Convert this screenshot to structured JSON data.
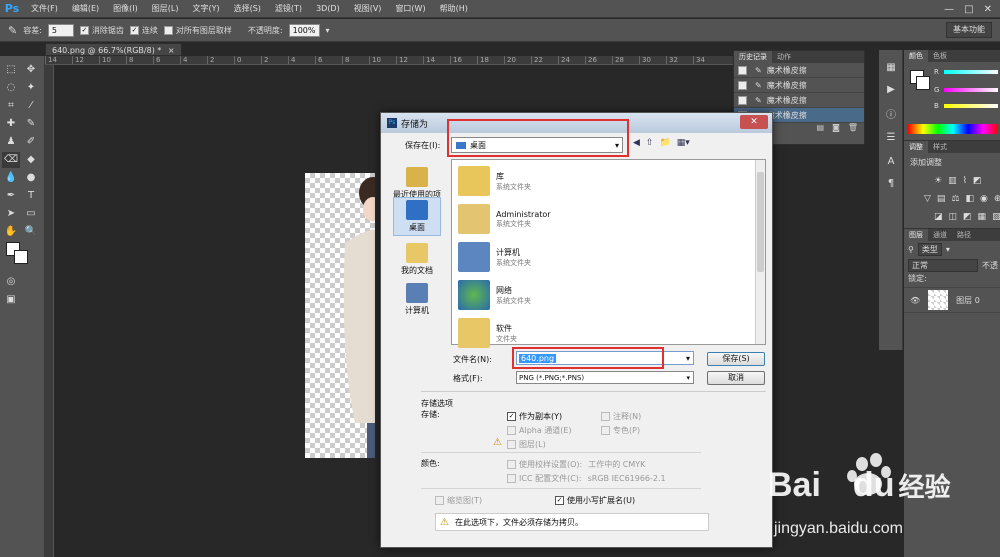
{
  "app": {
    "logo": "Ps"
  },
  "menu": [
    "文件(F)",
    "编辑(E)",
    "图像(I)",
    "图层(L)",
    "文字(Y)",
    "选择(S)",
    "滤镜(T)",
    "3D(D)",
    "视图(V)",
    "窗口(W)",
    "帮助(H)"
  ],
  "window_controls": [
    "—",
    "□",
    "✕"
  ],
  "options_bar": {
    "tolerance_label": "容差:",
    "tolerance_value": "5",
    "antialias_label": "消除锯齿",
    "antialias_checked": "✓",
    "contiguous_label": "连续",
    "contiguous_checked": "✓",
    "sample_all_label": "对所有图层取样",
    "opacity_label": "不透明度:",
    "opacity_value": "100%",
    "workspace": "基本功能"
  },
  "document": {
    "tab_label": "640.png @ 66.7%(RGB/8) *",
    "tab_close": "×"
  },
  "ruler_ticks": [
    "14",
    "12",
    "10",
    "8",
    "6",
    "4",
    "2",
    "0",
    "2",
    "4",
    "6",
    "8",
    "10",
    "12",
    "14",
    "16",
    "18",
    "20",
    "22",
    "24",
    "26",
    "28",
    "30",
    "32",
    "34"
  ],
  "history_panel": {
    "tabs": [
      "历史记录",
      "动作"
    ],
    "items": [
      "魔术橡皮擦",
      "魔术橡皮擦",
      "魔术橡皮擦",
      "魔术橡皮擦"
    ]
  },
  "color_panel": {
    "tabs": [
      "颜色",
      "色板"
    ],
    "channels": [
      "R",
      "G",
      "B"
    ]
  },
  "adjust_panel": {
    "tabs": [
      "调整",
      "样式"
    ],
    "title": "添加调整"
  },
  "layers_panel": {
    "tabs": [
      "图层",
      "通道",
      "路径"
    ],
    "kind": "类型",
    "blend_mode": "正常",
    "opacity_label": "不透",
    "lock_label": "锁定:",
    "layer_name": "图层 0"
  },
  "dialog": {
    "title": "存储为",
    "close": "✕",
    "save_in_label": "保存在(I):",
    "save_in_value": "桌面",
    "places": [
      "最近使用的项目",
      "桌面",
      "我的文档",
      "计算机"
    ],
    "files": [
      {
        "name": "库",
        "type": "系统文件夹"
      },
      {
        "name": "Administrator",
        "type": "系统文件夹"
      },
      {
        "name": "计算机",
        "type": "系统文件夹"
      },
      {
        "name": "网络",
        "type": "系统文件夹"
      },
      {
        "name": "软件",
        "type": "文件夹"
      }
    ],
    "filename_label": "文件名(N):",
    "filename_value": "640.png",
    "format_label": "格式(F):",
    "format_value": "PNG (*.PNG;*.PNS)",
    "save_button": "保存(S)",
    "cancel_button": "取消",
    "options_title": "存储选项",
    "storage_label": "存储:",
    "as_copy": "作为副本(Y)",
    "notes": "注释(N)",
    "alpha": "Alpha 通道(E)",
    "spot": "专色(P)",
    "layers": "图层(L)",
    "color_label": "颜色:",
    "proof": "使用校样设置(O):",
    "proof_value": "工作中的 CMYK",
    "icc": "ICC 配置文件(C):",
    "icc_value": "sRGB IEC61966-2.1",
    "thumbnail": "缩览图(T)",
    "lowercase_ext": "使用小写扩展名(U)",
    "warning": "在此选项下，文件必须存储为拷贝。"
  },
  "watermark": {
    "brand": "Bai",
    "brand2": "du",
    "product": "经验",
    "url": "jingyan.baidu.com"
  }
}
